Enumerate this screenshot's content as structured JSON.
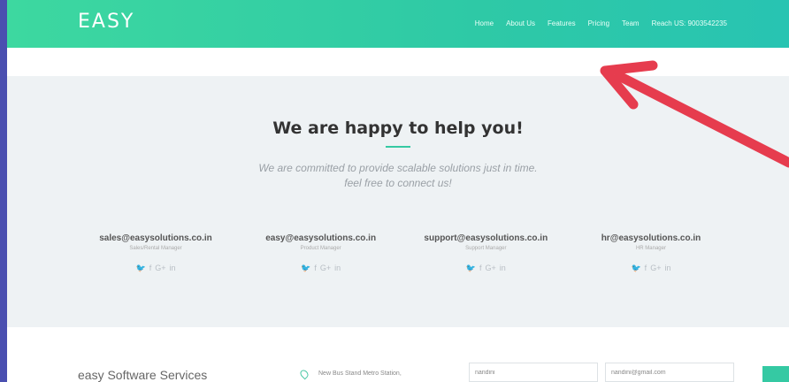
{
  "nav": {
    "brand": "EASY",
    "items": [
      "Home",
      "About Us",
      "Features",
      "Pricing",
      "Team",
      "Reach US: 9003542235"
    ]
  },
  "help": {
    "title": "We are happy to help you!",
    "subtitle_line1": "We are committed to provide scalable solutions just in time.",
    "subtitle_line2": "feel free to connect us!"
  },
  "contacts": [
    {
      "email": "sales@easysolutions.co.in",
      "role": "Sales/Rental Manager"
    },
    {
      "email": "easy@easysolutions.co.in",
      "role": "Product Manager"
    },
    {
      "email": "support@easysolutions.co.in",
      "role": "Support Manager"
    },
    {
      "email": "hr@easysolutions.co.in",
      "role": "HR Manager"
    }
  ],
  "social": {
    "twitter": "🐦",
    "facebook": "f",
    "gplus": "G+",
    "linkedin": "in"
  },
  "footer": {
    "company": "easy Software Services",
    "address": "New Bus Stand Metro Station,",
    "name_value": "nandini",
    "email_value": "nandini@gmail.com"
  },
  "colors": {
    "accent": "#35c9a3",
    "nav_start": "#3dd8a0",
    "arrow": "#e63c4e",
    "backdrop": "#4a4fb0"
  }
}
